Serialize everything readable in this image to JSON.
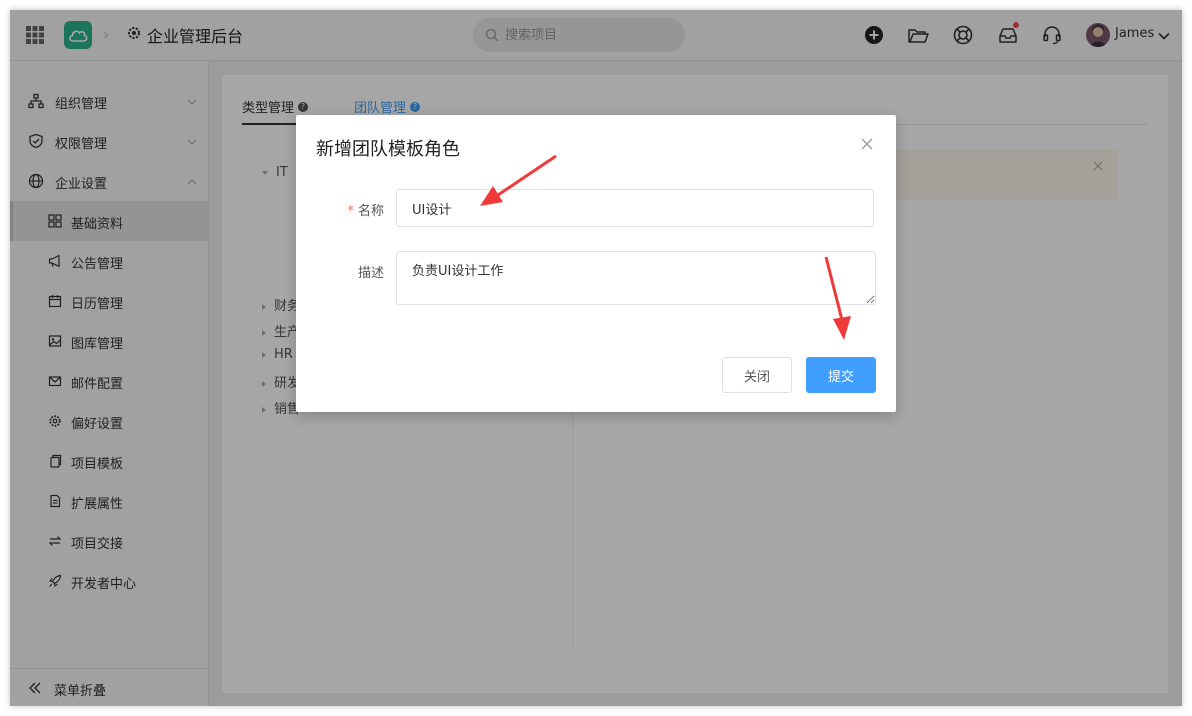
{
  "header": {
    "app_title": "企业管理后台",
    "search_placeholder": "搜索项目",
    "user_name": "James"
  },
  "sidebar": {
    "groups": [
      {
        "label": "组织管理",
        "icon": "org-chart-icon",
        "expanded": false
      },
      {
        "label": "权限管理",
        "icon": "shield-icon",
        "expanded": false
      },
      {
        "label": "企业设置",
        "icon": "globe-icon",
        "expanded": true
      }
    ],
    "items": [
      {
        "label": "基础资料",
        "icon": "grid-icon",
        "active": true
      },
      {
        "label": "公告管理",
        "icon": "megaphone-icon"
      },
      {
        "label": "日历管理",
        "icon": "calendar-icon"
      },
      {
        "label": "图库管理",
        "icon": "image-icon"
      },
      {
        "label": "邮件配置",
        "icon": "mail-icon"
      },
      {
        "label": "偏好设置",
        "icon": "gear-icon"
      },
      {
        "label": "项目模板",
        "icon": "copy-icon"
      },
      {
        "label": "扩展属性",
        "icon": "doc-icon"
      },
      {
        "label": "项目交接",
        "icon": "swap-icon"
      },
      {
        "label": "开发者中心",
        "icon": "rocket-icon"
      }
    ],
    "footer_label": "菜单折叠"
  },
  "tabs": [
    {
      "label": "类型管理",
      "active": true
    },
    {
      "label": "团队管理",
      "active": false
    }
  ],
  "tree": {
    "root": "IT",
    "items": [
      "财务",
      "生产",
      "HR",
      "研发",
      "销售"
    ]
  },
  "dialog": {
    "title": "新增团队模板角色",
    "name_label": "名称",
    "name_value": "UI设计",
    "desc_label": "描述",
    "desc_value": "负责UI设计工作",
    "cancel_label": "关闭",
    "submit_label": "提交"
  },
  "colors": {
    "brand": "#2bb38d",
    "primary": "#409eff",
    "required": "#f56c6c",
    "annotation_arrow": "#f0393a"
  }
}
